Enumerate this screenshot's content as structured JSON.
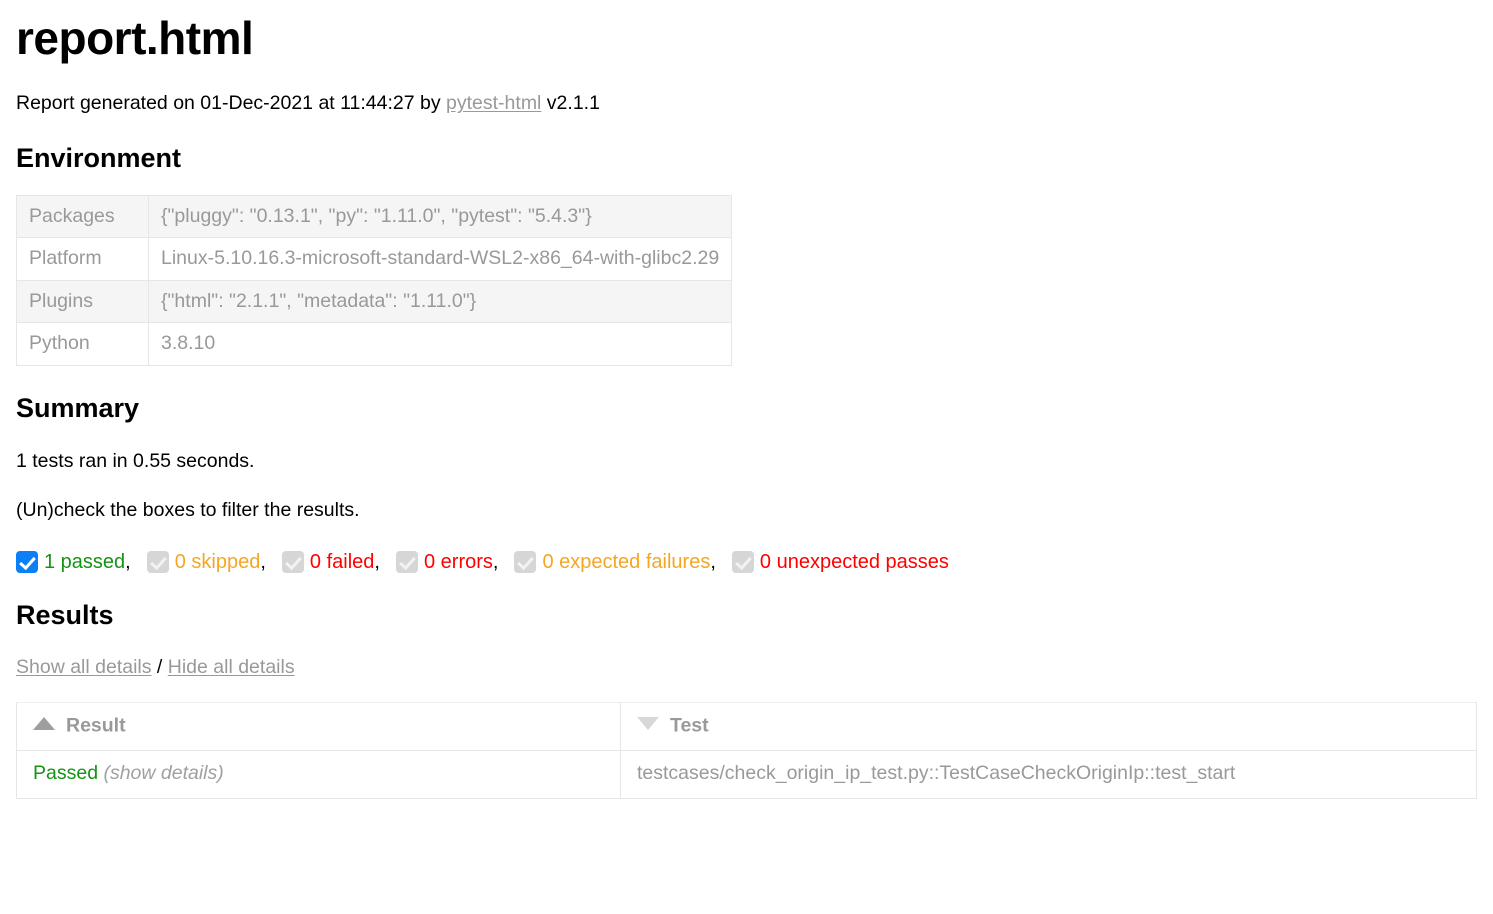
{
  "page": {
    "title": "report.html",
    "generated_prefix": "Report generated on 01-Dec-2021 at 11:44:27 by ",
    "generator_link": "pytest-html",
    "generator_version": " v2.1.1"
  },
  "environment": {
    "heading": "Environment",
    "rows": [
      {
        "key": "Packages",
        "value": "{\"pluggy\": \"0.13.1\", \"py\": \"1.11.0\", \"pytest\": \"5.4.3\"}"
      },
      {
        "key": "Platform",
        "value": "Linux-5.10.16.3-microsoft-standard-WSL2-x86_64-with-glibc2.29"
      },
      {
        "key": "Plugins",
        "value": "{\"html\": \"2.1.1\", \"metadata\": \"1.11.0\"}"
      },
      {
        "key": "Python",
        "value": "3.8.10"
      }
    ]
  },
  "summary": {
    "heading": "Summary",
    "run_line": "1 tests ran in 0.55 seconds.",
    "filter_hint": "(Un)check the boxes to filter the results.",
    "filters": [
      {
        "label": "1 passed",
        "checked": true,
        "enabled": true,
        "color": "#159415",
        "separator": ","
      },
      {
        "label": "0 skipped",
        "checked": true,
        "enabled": false,
        "color": "#f5a623",
        "separator": ","
      },
      {
        "label": "0 failed",
        "checked": true,
        "enabled": false,
        "color": "#ff0000",
        "separator": ","
      },
      {
        "label": "0 errors",
        "checked": true,
        "enabled": false,
        "color": "#ff0000",
        "separator": ","
      },
      {
        "label": "0 expected failures",
        "checked": true,
        "enabled": false,
        "color": "#f5a623",
        "separator": ","
      },
      {
        "label": "0 unexpected passes",
        "checked": true,
        "enabled": false,
        "color": "#ff0000",
        "separator": ""
      }
    ]
  },
  "results": {
    "heading": "Results",
    "show_all": "Show all details",
    "separator": "/",
    "hide_all": "Hide all details",
    "columns": [
      {
        "label": "Result",
        "sort": "asc"
      },
      {
        "label": "Test",
        "sort": "desc"
      }
    ],
    "rows": [
      {
        "result": "Passed",
        "details_label": "(show details)",
        "test": "testcases/check_origin_ip_test.py::TestCaseCheckOriginIp::test_start"
      }
    ]
  }
}
